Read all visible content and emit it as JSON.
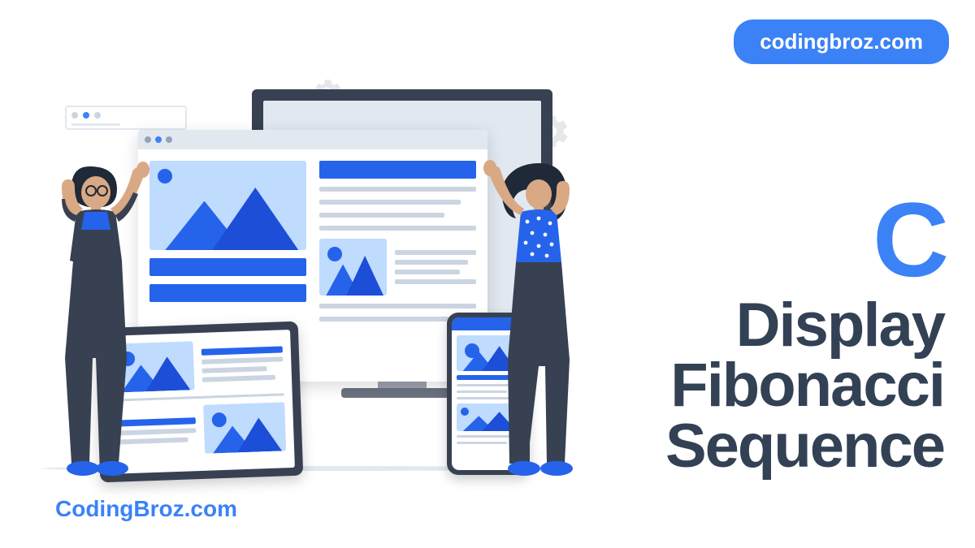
{
  "badge": {
    "text": "codingbroz.com"
  },
  "footer": {
    "brand": "CodingBroz.com"
  },
  "title": {
    "logo": "C",
    "line1": "Display",
    "line2": "Fibonacci",
    "line3": "Sequence"
  },
  "colors": {
    "accent": "#3b82f6",
    "darkText": "#334155",
    "darkFrame": "#374151"
  }
}
